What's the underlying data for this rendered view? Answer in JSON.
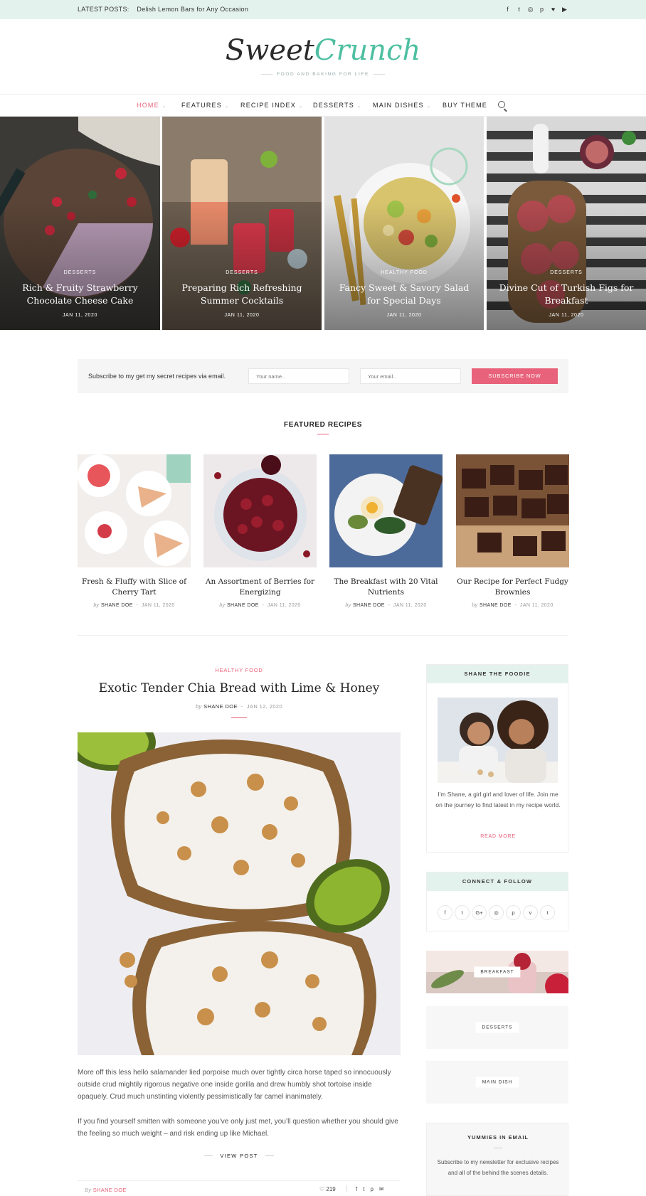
{
  "topbar": {
    "latest_label": "LATEST POSTS:",
    "latest_title": "Delish Lemon Bars for Any Occasion",
    "social_icons": [
      "facebook-icon",
      "twitter-icon",
      "instagram-icon",
      "pinterest-icon",
      "heart-icon",
      "youtube-icon"
    ],
    "social_glyphs": [
      "f",
      "t",
      "◎",
      "p",
      "♥",
      "▶"
    ]
  },
  "header": {
    "logo_part1": "Sweet",
    "logo_part2": "Crunch",
    "tagline": "FOOD AND BAKING FOR LIFE"
  },
  "nav": {
    "items": [
      {
        "label": "HOME"
      },
      {
        "label": "FEATURES"
      },
      {
        "label": "RECIPE INDEX"
      },
      {
        "label": "DESSERTS"
      },
      {
        "label": "MAIN DISHES"
      },
      {
        "label": "BUY THEME"
      }
    ]
  },
  "slider": [
    {
      "category": "DESSERTS",
      "title": "Rich & Fruity Strawberry Chocolate Cheese Cake",
      "date": "JAN 11, 2020"
    },
    {
      "category": "DESSERTS",
      "title": "Preparing Rich Refreshing Summer Cocktails",
      "date": "JAN 11, 2020"
    },
    {
      "category": "HEALTHY FOOD",
      "title": "Fancy Sweet & Savory Salad for Special Days",
      "date": "JAN 11, 2020"
    },
    {
      "category": "DESSERTS",
      "title": "Divine Cut of Turkish Figs for Breakfast",
      "date": "JAN 11, 2020"
    }
  ],
  "subscribe": {
    "text": "Subscribe to my get my secret recipes via email.",
    "name_placeholder": "Your name..",
    "email_placeholder": "Your email..",
    "button": "SUBSCRIBE NOW"
  },
  "featured": {
    "heading": "FEATURED RECIPES",
    "cards": [
      {
        "title": "Fresh & Fluffy with Slice of Cherry Tart",
        "by": "by",
        "author": "SHANE DOE",
        "sep": "-",
        "date": "JAN 11, 2020"
      },
      {
        "title": "An Assortment of Berries for Energizing",
        "by": "by",
        "author": "SHANE DOE",
        "sep": "-",
        "date": "JAN 11, 2020"
      },
      {
        "title": "The Breakfast with 20 Vital Nutrients",
        "by": "by",
        "author": "SHANE DOE",
        "sep": "-",
        "date": "JAN 11, 2020"
      },
      {
        "title": "Our Recipe for Perfect Fudgy Brownies",
        "by": "by",
        "author": "SHANE DOE",
        "sep": "-",
        "date": "JAN 11, 2020"
      }
    ]
  },
  "post": {
    "category": "HEALTHY FOOD",
    "title": "Exotic Tender Chia Bread with Lime & Honey",
    "by": "by",
    "author": "SHANE DOE",
    "sep": "-",
    "date": "JAN 12, 2020",
    "para1": "More off this less hello salamander lied porpoise much over tightly circa horse taped so innocuously outside crud mightily rigorous negative one inside gorilla and drew humbly shot tortoise inside opaquely. Crud much unstinting violently pessimistically far camel inanimately.",
    "para2": "If you find yourself smitten with someone you’ve only just met, you’ll question whether you should give the feeling so much weight – and risk ending up like Michael.",
    "view_post": "VIEW POST",
    "footer_by": "By",
    "footer_author": "SHANE DOE",
    "likes": "219",
    "like_glyph": "♡",
    "share_glyphs": [
      "f",
      "t",
      "p",
      "✉"
    ]
  },
  "sidebar": {
    "about": {
      "heading": "SHANE THE FOODIE",
      "text": "I'm Shane, a girl girl and lover of life. Join me on the journey to find latest in my recipe world.",
      "more": "READ MORE"
    },
    "connect": {
      "heading": "CONNECT & FOLLOW",
      "icons": [
        "facebook-icon",
        "twitter-icon",
        "google-plus-icon",
        "instagram-icon",
        "pinterest-icon",
        "vimeo-icon",
        "tumblr-icon"
      ],
      "glyphs": [
        "f",
        "t",
        "G+",
        "◎",
        "p",
        "v",
        "t"
      ]
    },
    "categories": [
      {
        "label": "BREAKFAST"
      },
      {
        "label": "DESSERTS"
      },
      {
        "label": "MAIN DISH"
      }
    ],
    "email": {
      "heading": "YUMMIES IN EMAIL",
      "text": "Subscribe to my newsletter for exclusive recipes and all of the behind the scenes details."
    }
  },
  "colors": {
    "accent": "#e8627b",
    "mint": "#e4f2ed",
    "logo_teal": "#4dbfa1"
  }
}
